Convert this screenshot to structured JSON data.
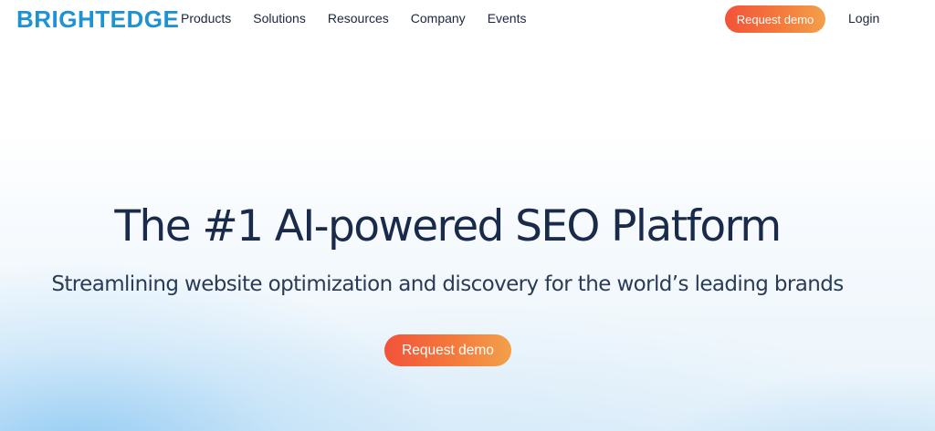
{
  "header": {
    "logo": "BRIGHTEDGE",
    "nav": [
      {
        "label": "Products"
      },
      {
        "label": "Solutions"
      },
      {
        "label": "Resources"
      },
      {
        "label": "Company"
      },
      {
        "label": "Events"
      }
    ],
    "cta_label": "Request demo",
    "login_label": "Login"
  },
  "hero": {
    "title": "The #1 AI-powered SEO Platform",
    "subtitle": "Streamlining website optimization and discovery for the world’s leading brands",
    "cta_label": "Request demo"
  },
  "colors": {
    "brand": "#1e93d2",
    "text_dark": "#1a2a4a",
    "cta_gradient_start": "#f2533a",
    "cta_gradient_end": "#f3a04a"
  }
}
